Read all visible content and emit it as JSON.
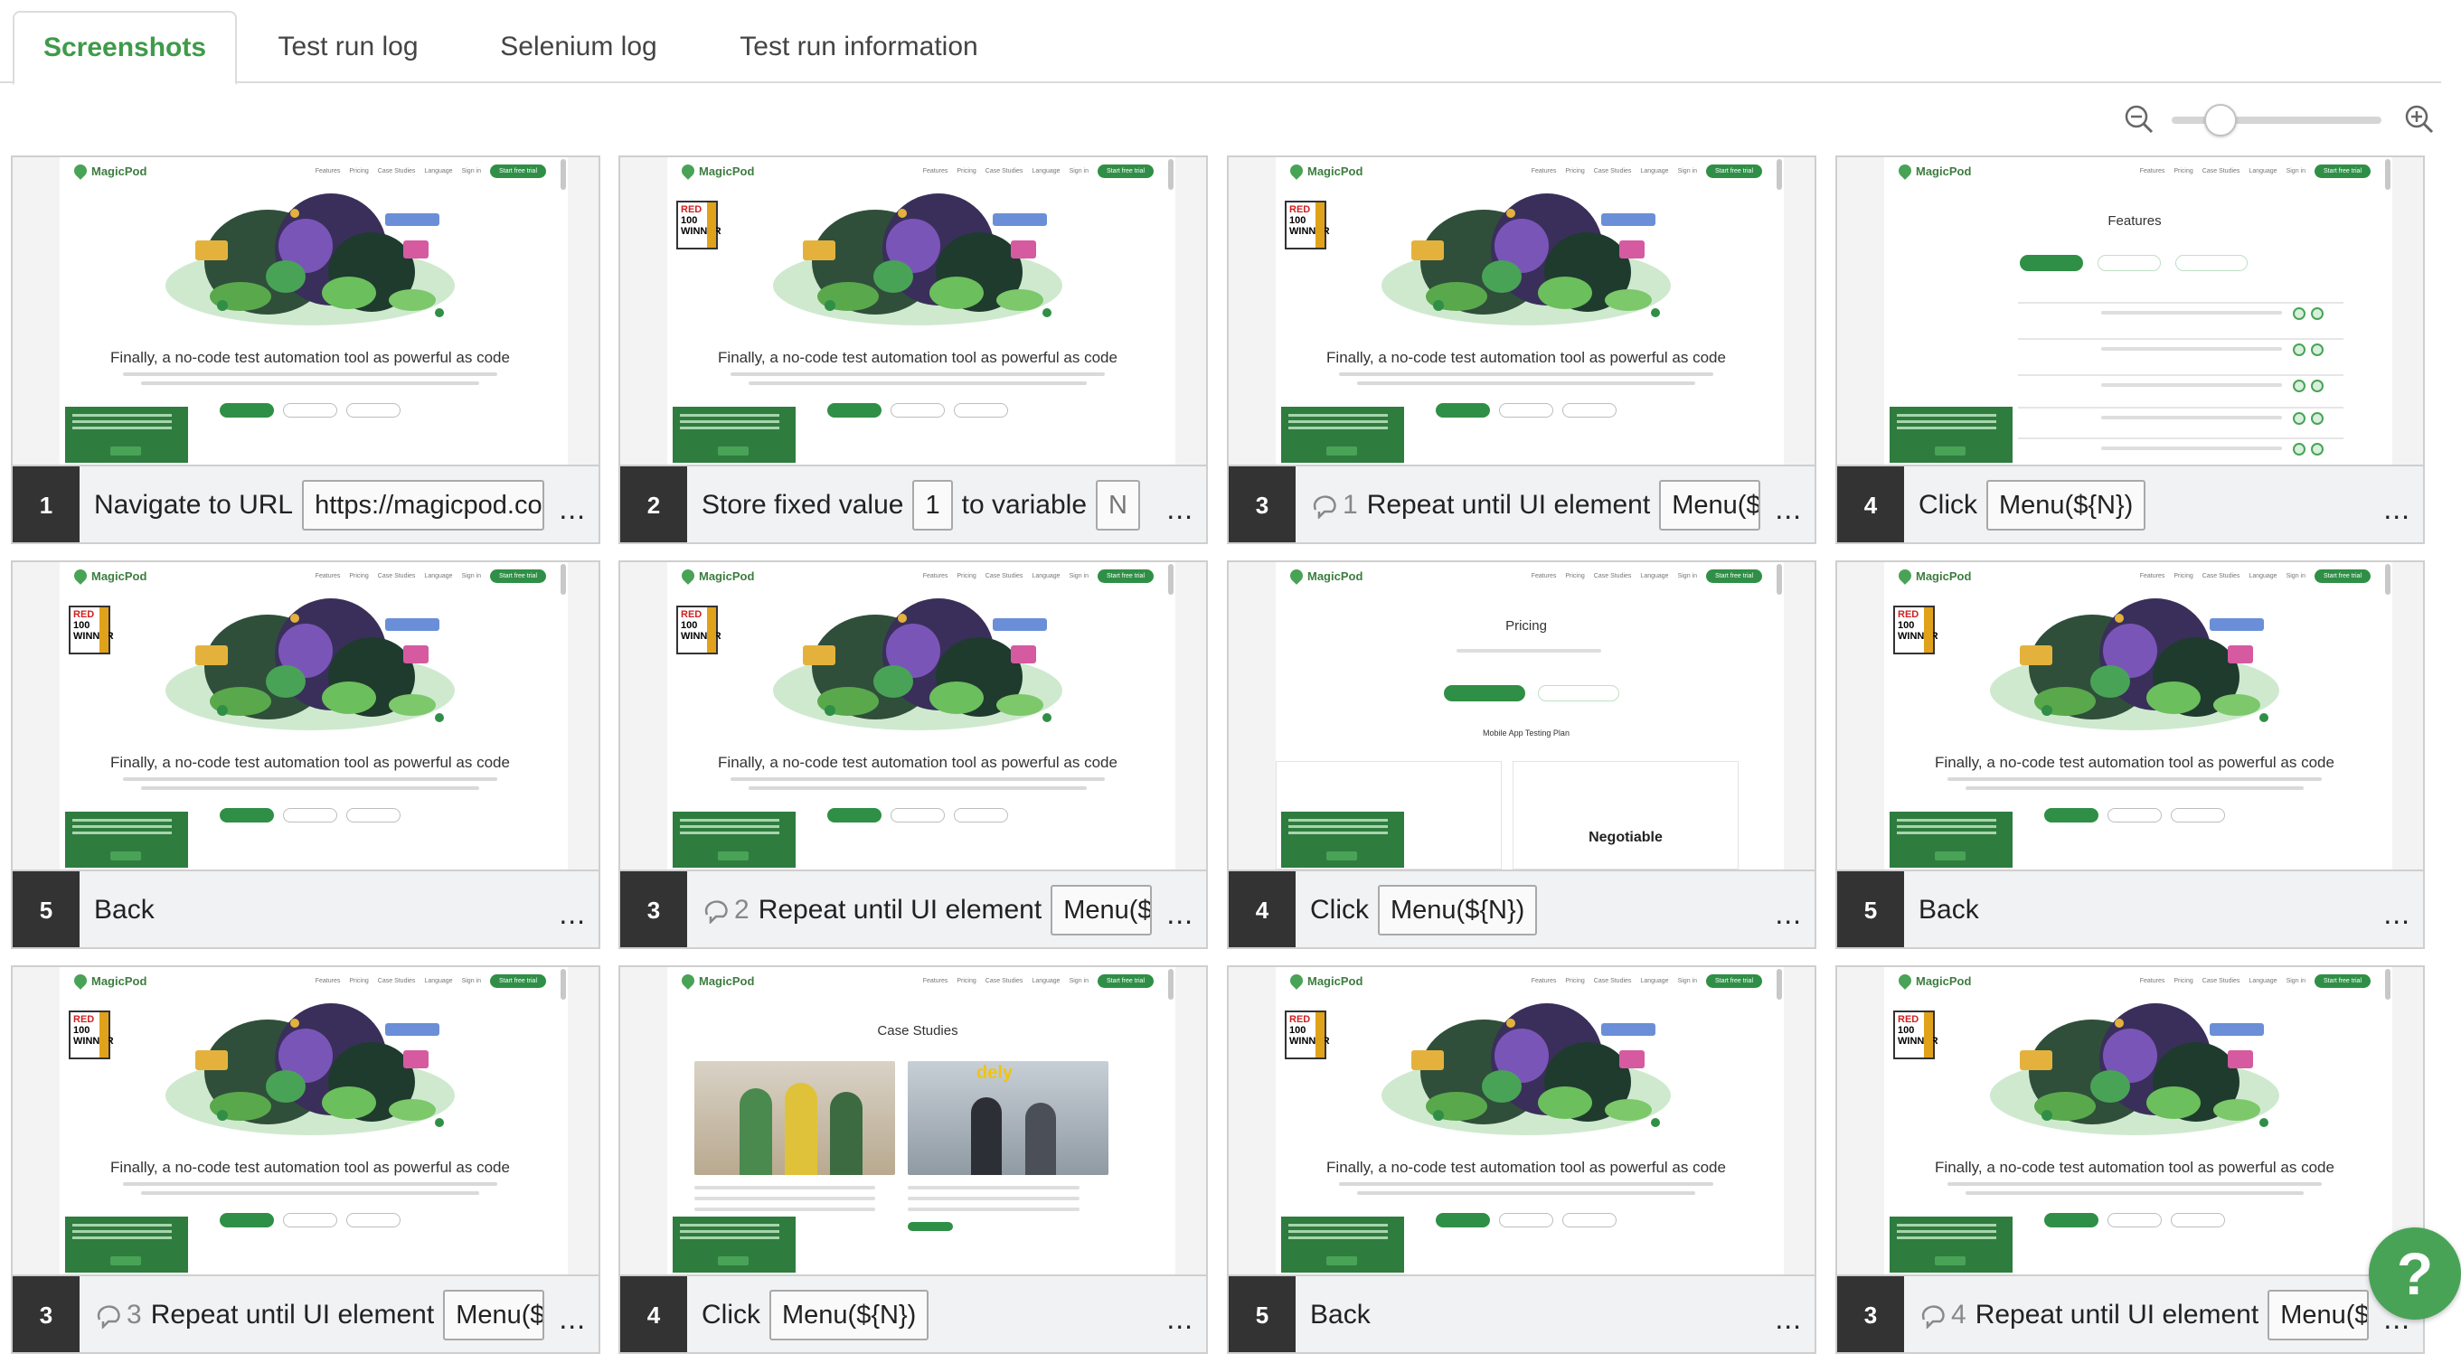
{
  "tabs": [
    {
      "label": "Screenshots",
      "active": true
    },
    {
      "label": "Test run log"
    },
    {
      "label": "Selenium log"
    },
    {
      "label": "Test run information"
    }
  ],
  "site": {
    "logo_text": "MagicPod",
    "nav_links": [
      "Features",
      "Pricing",
      "Case Studies",
      "Language",
      "Sign in"
    ],
    "trial_button": "Start free trial",
    "hero_title": "Finally, a no-code test automation tool as powerful as code",
    "badge_lines": [
      "RED",
      "100",
      "WINNER"
    ],
    "features_title": "Features",
    "pricing_title": "Pricing",
    "pricing_plan_heading": "Mobile App Testing Plan",
    "pricing_negotiable": "Negotiable",
    "case_title": "Case Studies",
    "case_logo_dely": "dely"
  },
  "cards": [
    {
      "num": "1",
      "kind": "home",
      "badge": false,
      "cmd": "Navigate to URL",
      "params": [
        "https://magicpod.com"
      ]
    },
    {
      "num": "2",
      "kind": "home",
      "badge": true,
      "cmd": "Store fixed value",
      "params": [
        "1"
      ],
      "extra": "to variable",
      "params2": [
        "N"
      ]
    },
    {
      "num": "3",
      "kind": "home",
      "badge": true,
      "loop": "1",
      "cmd": "Repeat until UI element",
      "params": [
        "Menu(${N})"
      ]
    },
    {
      "num": "4",
      "kind": "features",
      "cmd": "Click",
      "params": [
        "Menu(${N})"
      ]
    },
    {
      "num": "5",
      "kind": "home",
      "badge": true,
      "cmd": "Back",
      "params": []
    },
    {
      "num": "3",
      "kind": "home",
      "badge": true,
      "loop": "2",
      "cmd": "Repeat until UI element",
      "params": [
        "Menu(${N})"
      ]
    },
    {
      "num": "4",
      "kind": "pricing",
      "cmd": "Click",
      "params": [
        "Menu(${N})"
      ]
    },
    {
      "num": "5",
      "kind": "home",
      "badge": true,
      "cmd": "Back",
      "params": []
    },
    {
      "num": "3",
      "kind": "home",
      "badge": true,
      "loop": "3",
      "cmd": "Repeat until UI element",
      "params": [
        "Menu(${N})"
      ]
    },
    {
      "num": "4",
      "kind": "cases",
      "cmd": "Click",
      "params": [
        "Menu(${N})"
      ]
    },
    {
      "num": "5",
      "kind": "home",
      "badge": true,
      "cmd": "Back",
      "params": []
    },
    {
      "num": "3",
      "kind": "home",
      "badge": true,
      "loop": "4",
      "cmd": "Repeat until UI element",
      "params": [
        "Menu(${N})"
      ]
    }
  ],
  "more_label": "...",
  "help_label": "?",
  "colors": {
    "accent": "#3f9a49",
    "brand_green": "#2f8f46",
    "step_number_bg": "#333333"
  }
}
